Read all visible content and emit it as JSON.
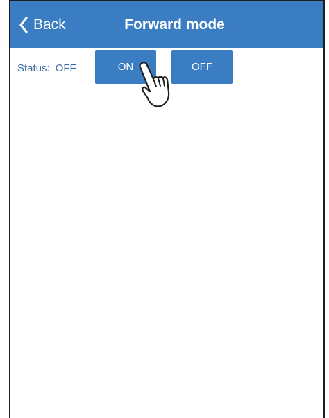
{
  "navbar": {
    "back_label": "Back",
    "back_icon": "chevron-left-icon",
    "title": "Forward mode"
  },
  "status": {
    "label": "Status:",
    "value": "OFF"
  },
  "buttons": {
    "on_label": "ON",
    "off_label": "OFF"
  },
  "pointer_icon": "hand-pointer-icon",
  "colors": {
    "accent": "#3a7dc2",
    "status_text": "#3a6ea5",
    "button_text": "#ffffff",
    "background": "#ffffff"
  }
}
